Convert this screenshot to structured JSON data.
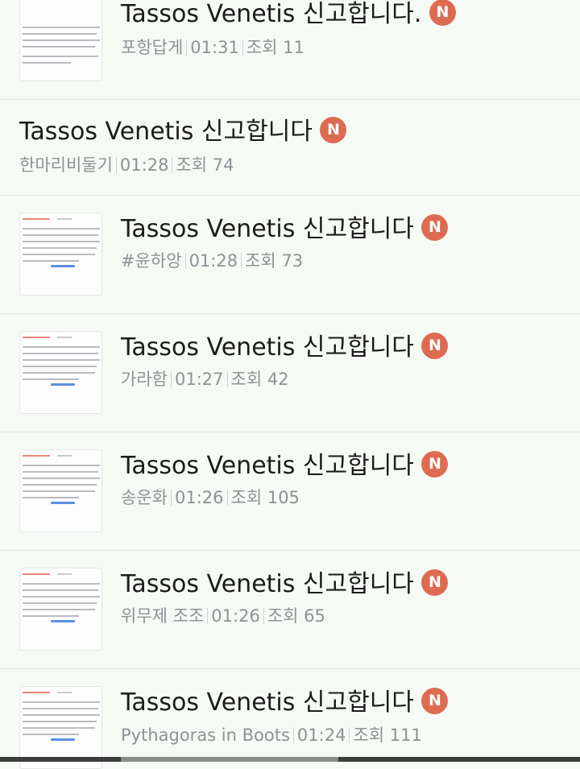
{
  "posts": [
    {
      "title": "Tassos Venetis 신고합니다.",
      "badge": "N",
      "author": "포항답게",
      "time": "01:31",
      "views_label": "조회",
      "views": "11",
      "has_thumb": true
    },
    {
      "title": "Tassos Venetis 신고합니다",
      "badge": "N",
      "author": "한마리비둘기",
      "time": "01:28",
      "views_label": "조회",
      "views": "74",
      "has_thumb": false
    },
    {
      "title": "Tassos Venetis 신고합니다 ",
      "badge": "N",
      "author": "#윤하앙",
      "time": "01:28",
      "views_label": "조회",
      "views": "73",
      "has_thumb": true
    },
    {
      "title": "Tassos Venetis 신고합니다",
      "badge": "N",
      "author": "가라함",
      "time": "01:27",
      "views_label": "조회",
      "views": "42",
      "has_thumb": true
    },
    {
      "title": "Tassos Venetis 신고합니다",
      "badge": "N",
      "author": "송운화",
      "time": "01:26",
      "views_label": "조회",
      "views": "105",
      "has_thumb": true
    },
    {
      "title": "Tassos Venetis 신고합니다 ",
      "badge": "N",
      "author": "위무제 조조",
      "time": "01:26",
      "views_label": "조회",
      "views": "65",
      "has_thumb": true
    },
    {
      "title": "Tassos Venetis 신고합니다",
      "badge": "N",
      "author": "Pythagoras in Boots",
      "time": "01:24",
      "views_label": "조회",
      "views": "111",
      "has_thumb": true
    }
  ],
  "colors": {
    "badge": "#dd6b52",
    "background": "#f6faf5",
    "meta": "#8f9196"
  }
}
